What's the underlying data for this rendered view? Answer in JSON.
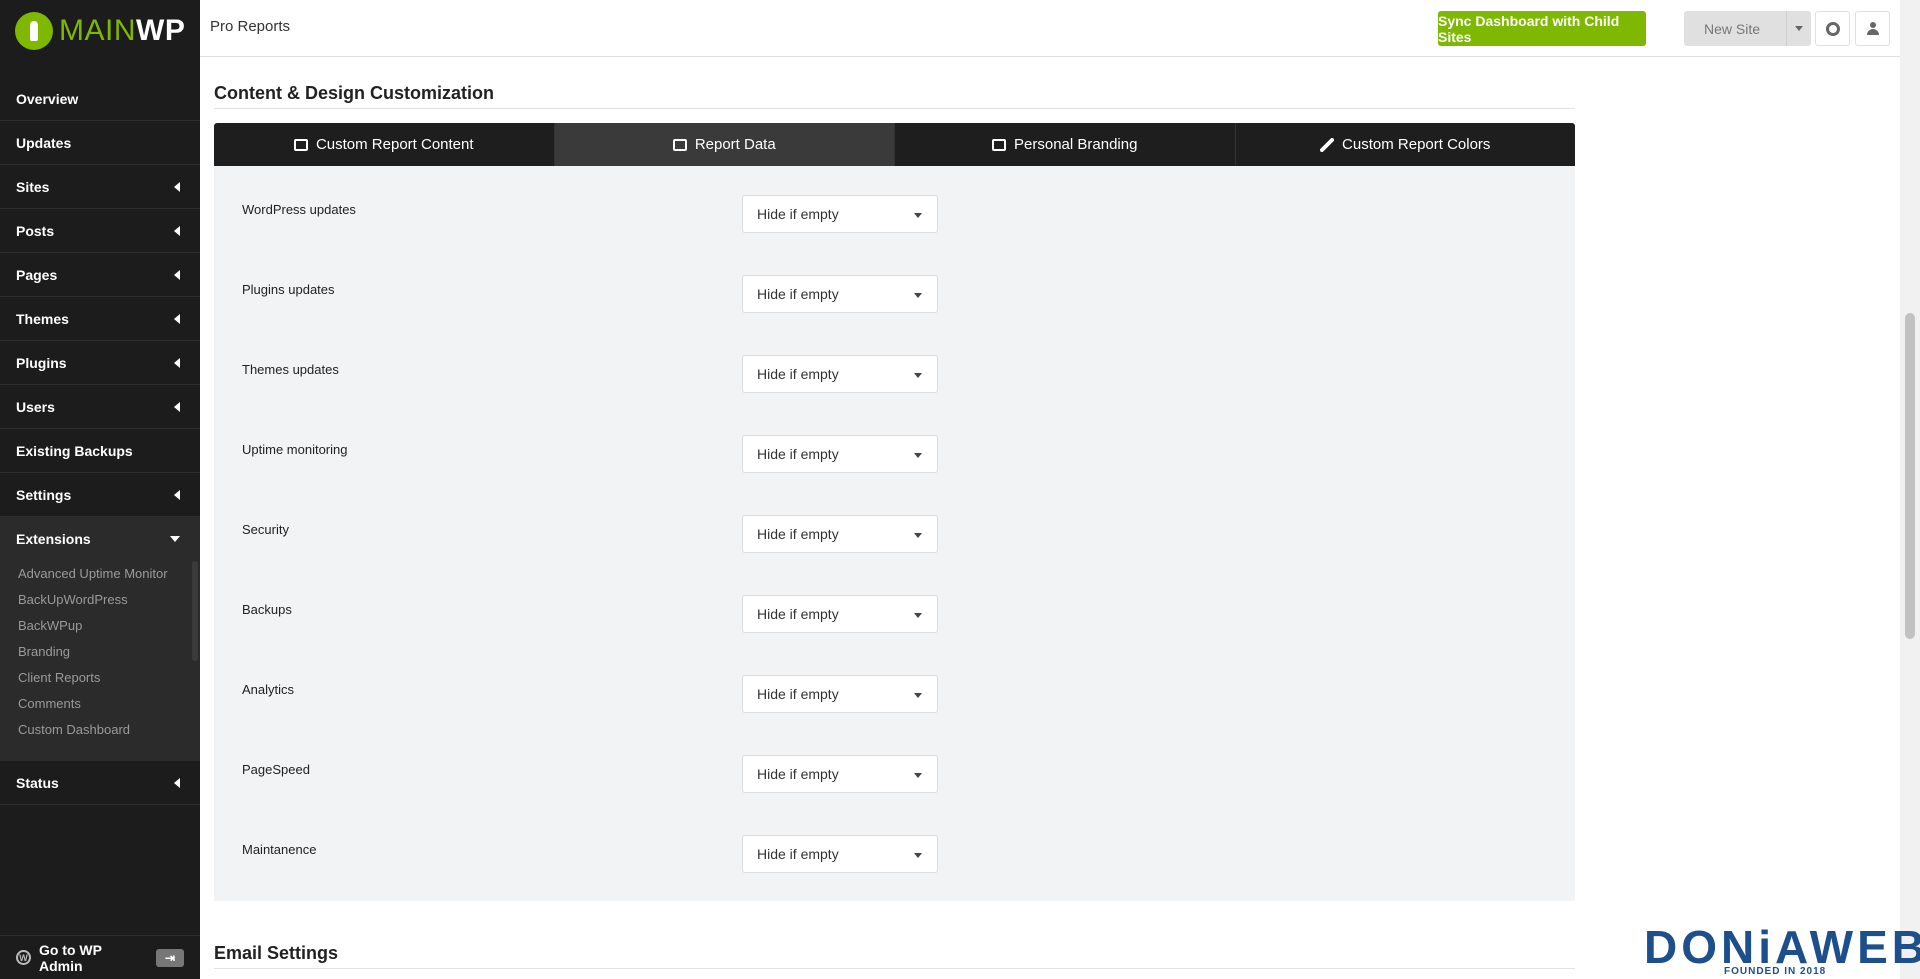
{
  "app": {
    "brand_main": "MAIN",
    "brand_wp": "WP",
    "page_title": "Pro Reports"
  },
  "sidebar": {
    "items": [
      {
        "label": "Overview",
        "has_caret": false
      },
      {
        "label": "Updates",
        "has_caret": false
      },
      {
        "label": "Sites",
        "has_caret": true
      },
      {
        "label": "Posts",
        "has_caret": true
      },
      {
        "label": "Pages",
        "has_caret": true
      },
      {
        "label": "Themes",
        "has_caret": true
      },
      {
        "label": "Plugins",
        "has_caret": true
      },
      {
        "label": "Users",
        "has_caret": true
      },
      {
        "label": "Existing Backups",
        "has_caret": false
      },
      {
        "label": "Settings",
        "has_caret": true
      },
      {
        "label": "Extensions",
        "has_caret": true,
        "expanded": true
      }
    ],
    "extensions_submenu": [
      "Advanced Uptime Monitor",
      "BackUpWordPress",
      "BackWPup",
      "Branding",
      "Client Reports",
      "Comments",
      "Custom Dashboard"
    ],
    "status_label": "Status",
    "go_admin_label": "Go to WP Admin"
  },
  "topbar": {
    "sync_label": "Sync Dashboard with Child Sites",
    "new_site_label": "New Site",
    "help_icon": "lifebuoy-icon",
    "user_icon": "user-icon"
  },
  "content": {
    "section_title": "Content & Design Customization",
    "tabs": [
      {
        "label": "Custom Report Content",
        "icon": "edit-icon",
        "active": false
      },
      {
        "label": "Report Data",
        "icon": "checkbox-icon",
        "active": true
      },
      {
        "label": "Personal Branding",
        "icon": "image-icon",
        "active": false
      },
      {
        "label": "Custom Report Colors",
        "icon": "brush-icon",
        "active": false
      }
    ],
    "rows": [
      {
        "label": "WordPress updates",
        "value": "Hide if empty"
      },
      {
        "label": "Plugins updates",
        "value": "Hide if empty"
      },
      {
        "label": "Themes updates",
        "value": "Hide if empty"
      },
      {
        "label": "Uptime monitoring",
        "value": "Hide if empty"
      },
      {
        "label": "Security",
        "value": "Hide if empty"
      },
      {
        "label": "Backups",
        "value": "Hide if empty"
      },
      {
        "label": "Analytics",
        "value": "Hide if empty"
      },
      {
        "label": "PageSpeed",
        "value": "Hide if empty"
      },
      {
        "label": "Maintanence",
        "value": "Hide if empty"
      }
    ],
    "email_section_title": "Email Settings"
  },
  "watermark": {
    "text": "DONiAWEB",
    "sub": "FOUNDED IN 2018"
  },
  "colors": {
    "accent": "#7fb800",
    "sidebar_bg": "#1c1c1c",
    "tabs_bg": "#1e1e1e",
    "panel_bg": "#f2f3f4",
    "watermark": "#1d4f8c"
  }
}
